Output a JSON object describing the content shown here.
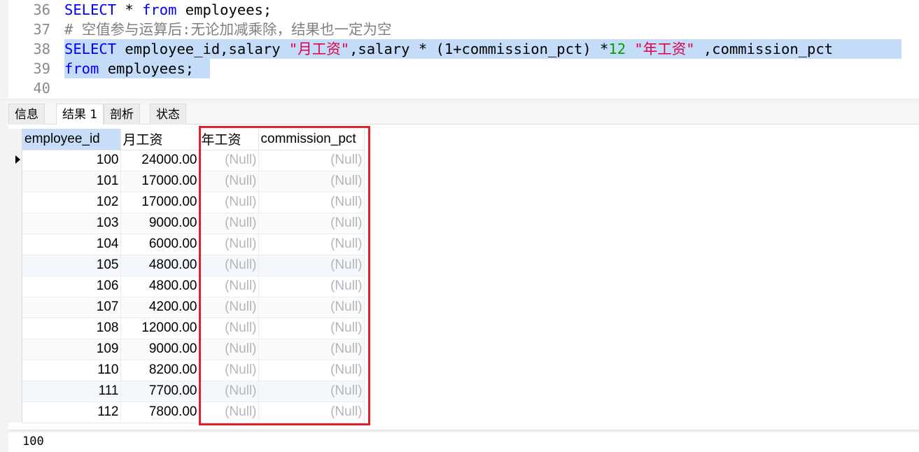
{
  "editor": {
    "lines": [
      {
        "no": "36",
        "tokens": [
          {
            "t": "SELECT",
            "c": "kw"
          },
          {
            "t": " * ",
            "c": "plain"
          },
          {
            "t": "from",
            "c": "kw"
          },
          {
            "t": " employees;",
            "c": "plain"
          }
        ]
      },
      {
        "no": "37",
        "tokens": [
          {
            "t": "# 空值参与运算后:无论加减乘除，结果也一定为空",
            "c": "cmt"
          }
        ]
      },
      {
        "no": "38",
        "tokens": [
          {
            "t": "SELECT",
            "c": "kw"
          },
          {
            "t": " employee_id,salary ",
            "c": "plain"
          },
          {
            "t": "\"月工资\"",
            "c": "str"
          },
          {
            "t": ",salary * (1+commission_pct) *",
            "c": "plain"
          },
          {
            "t": "12",
            "c": "num"
          },
          {
            "t": " ",
            "c": "plain"
          },
          {
            "t": "\"年工资\"",
            "c": "str"
          },
          {
            "t": " ,commission_pct",
            "c": "plain"
          }
        ]
      },
      {
        "no": "39",
        "tokens": [
          {
            "t": "from",
            "c": "kw"
          },
          {
            "t": " employees;",
            "c": "plain"
          }
        ]
      },
      {
        "no": "40",
        "tokens": []
      }
    ]
  },
  "tabs": [
    {
      "label": "信息",
      "active": false
    },
    {
      "label": "结果 1",
      "active": true
    },
    {
      "label": "剖析",
      "active": false
    },
    {
      "label": "状态",
      "active": false
    }
  ],
  "grid": {
    "columns": [
      "employee_id",
      "月工资",
      "年工资",
      "commission_pct"
    ],
    "rows": [
      [
        "100",
        "24000.00",
        "(Null)",
        "(Null)"
      ],
      [
        "101",
        "17000.00",
        "(Null)",
        "(Null)"
      ],
      [
        "102",
        "17000.00",
        "(Null)",
        "(Null)"
      ],
      [
        "103",
        "9000.00",
        "(Null)",
        "(Null)"
      ],
      [
        "104",
        "6000.00",
        "(Null)",
        "(Null)"
      ],
      [
        "105",
        "4800.00",
        "(Null)",
        "(Null)"
      ],
      [
        "106",
        "4800.00",
        "(Null)",
        "(Null)"
      ],
      [
        "107",
        "4200.00",
        "(Null)",
        "(Null)"
      ],
      [
        "108",
        "12000.00",
        "(Null)",
        "(Null)"
      ],
      [
        "109",
        "9000.00",
        "(Null)",
        "(Null)"
      ],
      [
        "110",
        "8200.00",
        "(Null)",
        "(Null)"
      ],
      [
        "111",
        "7700.00",
        "(Null)",
        "(Null)"
      ],
      [
        "112",
        "7800.00",
        "(Null)",
        "(Null)"
      ]
    ]
  },
  "status": {
    "value": "100"
  },
  "colors": {
    "highlight_box": "#e0202a",
    "selection": "#c5dcf8",
    "keyword": "#0000ff",
    "string": "#e0004a",
    "number": "#00a000",
    "null_text": "#b4b4bc"
  }
}
